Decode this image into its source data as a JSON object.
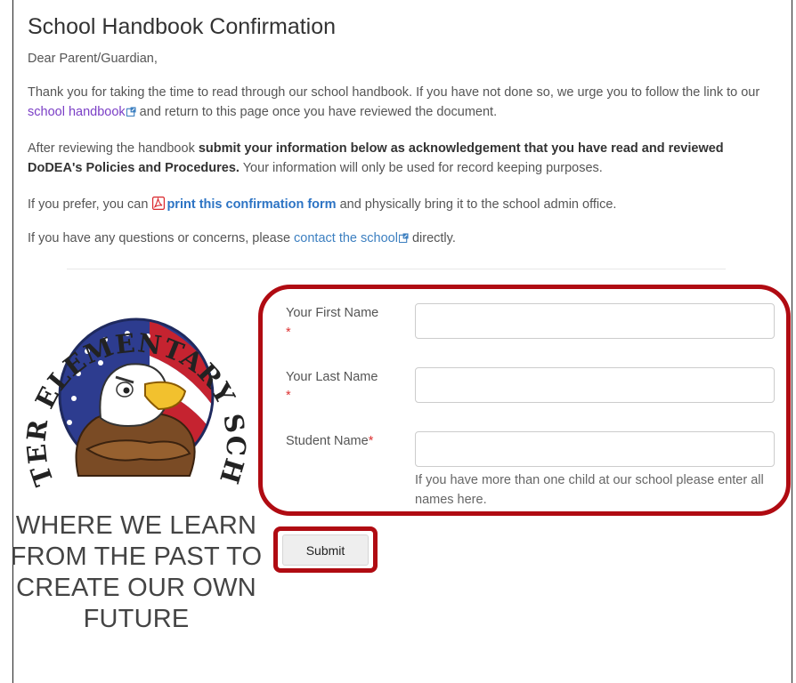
{
  "page": {
    "title": "School Handbook Confirmation",
    "greeting": "Dear Parent/Guardian,",
    "para1_before": "Thank you for taking the time to read through our school handbook. If you have not done so, we urge you to follow the link to our ",
    "para1_link": "school handbook",
    "para1_after": " and return to this page once you have reviewed the document.",
    "para2_before": "After reviewing the handbook ",
    "para2_bold": "submit your information below as acknowledgement that you have read and reviewed DoDEA's Policies and Procedures.",
    "para2_after": " Your information will only be used for record keeping purposes.",
    "para3_before": "If you prefer, you can ",
    "para3_link": "print this confirmation form",
    "para3_after": " and physically bring it to the school admin office.",
    "para4_before": "If you have any questions or concerns, please ",
    "para4_link": "contact the school",
    "para4_after": " directly."
  },
  "logo": {
    "arc_text": "DEXTER ELEMENTARY SCHOOL"
  },
  "motto": "WHERE WE LEARN FROM THE PAST TO CREATE OUR OWN FUTURE",
  "form": {
    "first_name_label": "Your First Name",
    "last_name_label": "Your Last Name",
    "student_name_label": "Student Name",
    "required_mark": "*",
    "first_name_value": "",
    "last_name_value": "",
    "student_name_value": "",
    "hint": "If you have more than one child at our school please enter all names here.",
    "submit_label": "Submit"
  },
  "colors": {
    "highlight": "#b00b12",
    "link_purple": "#7b3fc6",
    "link_blue": "#3c7fc0",
    "required": "#dd3333"
  }
}
